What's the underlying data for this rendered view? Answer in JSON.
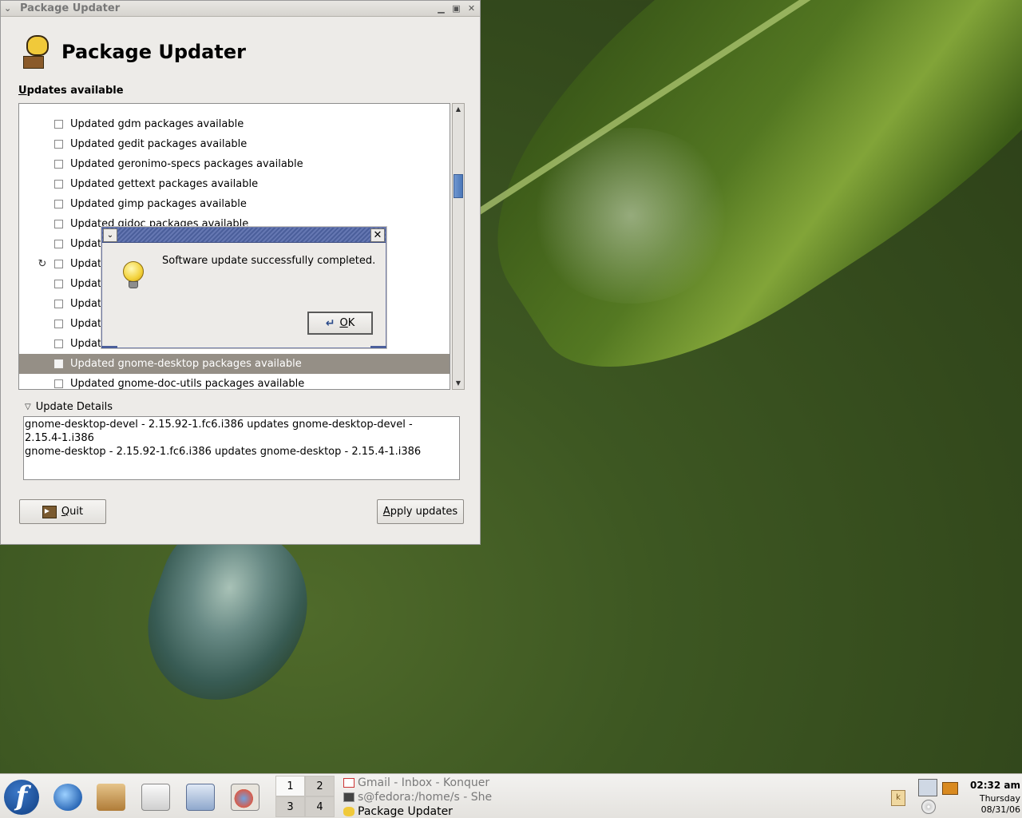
{
  "window": {
    "title": "Package Updater",
    "app_title": "Package Updater",
    "updates_label_underlined": "U",
    "updates_label_rest": "pdates available",
    "updates": [
      {
        "label": "Updated gdm packages available",
        "checked": false,
        "status_icon": ""
      },
      {
        "label": "Updated gedit packages available",
        "checked": false,
        "status_icon": ""
      },
      {
        "label": "Updated geronimo-specs packages available",
        "checked": false,
        "status_icon": ""
      },
      {
        "label": "Updated gettext packages available",
        "checked": false,
        "status_icon": ""
      },
      {
        "label": "Updated gimp packages available",
        "checked": false,
        "status_icon": ""
      },
      {
        "label": "Updated gjdoc packages available",
        "checked": false,
        "status_icon": ""
      },
      {
        "label": "Updat",
        "checked": false,
        "status_icon": ""
      },
      {
        "label": "Updat",
        "checked": false,
        "status_icon": "refresh-icon"
      },
      {
        "label": "Updat",
        "checked": false,
        "status_icon": ""
      },
      {
        "label": "Updat",
        "checked": false,
        "status_icon": ""
      },
      {
        "label": "Updat",
        "checked": false,
        "status_icon": ""
      },
      {
        "label": "Updat",
        "checked": false,
        "status_icon": ""
      },
      {
        "label": "Updated gnome-desktop packages available",
        "checked": false,
        "status_icon": "",
        "selected": true
      },
      {
        "label": "Updated gnome-doc-utils packages available",
        "checked": false,
        "status_icon": ""
      }
    ],
    "details_label": "Update Details",
    "details_lines": [
      "gnome-desktop-devel - 2.15.92-1.fc6.i386 updates gnome-desktop-devel -",
      "2.15.4-1.i386",
      "gnome-desktop - 2.15.92-1.fc6.i386 updates gnome-desktop - 2.15.4-1.i386"
    ],
    "quit_underlined": "Q",
    "quit_rest": "uit",
    "apply_underlined": "A",
    "apply_rest": "pply updates"
  },
  "dialog": {
    "message": "Software update successfully completed.",
    "ok_underlined": "O",
    "ok_rest": "K",
    "icon": "lightbulb-icon"
  },
  "taskbar": {
    "pager": [
      "1",
      "2",
      "3",
      "4"
    ],
    "tasks": [
      {
        "label": "Gmail - Inbox - Konquer",
        "icon": "gmail-icon",
        "active": false
      },
      {
        "label": "s@fedora:/home/s - She",
        "icon": "terminal-icon",
        "active": false
      },
      {
        "label": "Package Updater",
        "icon": "package-updater-icon",
        "active": true
      }
    ],
    "clock": {
      "time": "02:32 am",
      "day": "Thursday",
      "date": "08/31/06"
    },
    "tray_k": "k"
  }
}
